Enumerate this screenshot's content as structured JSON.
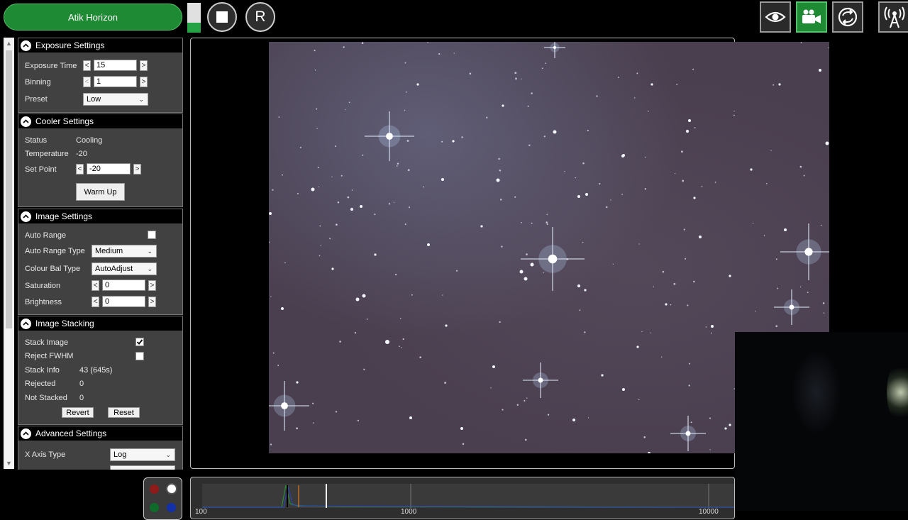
{
  "top": {
    "camera_name": "Atik Horizon",
    "reset_label": "R",
    "level": 0.33,
    "colors": {
      "accent_green": "#1f8a34",
      "panel": "#414141"
    }
  },
  "toolbar_icons": [
    "eye-icon",
    "video-camera-icon",
    "sync-icon",
    "antenna-icon"
  ],
  "exposure": {
    "title": "Exposure Settings",
    "exposure_label": "Exposure Time",
    "exposure_value": "15",
    "binning_label": "Binning",
    "binning_value": "1",
    "preset_label": "Preset",
    "preset_value": "Low",
    "dec": "<",
    "inc": ">"
  },
  "cooler": {
    "title": "Cooler Settings",
    "status_label": "Status",
    "status_value": "Cooling",
    "temp_label": "Temperature",
    "temp_value": "-20",
    "setpoint_label": "Set Point",
    "setpoint_value": "-20",
    "warm_up": "Warm Up"
  },
  "image": {
    "title": "Image Settings",
    "auto_range_label": "Auto Range",
    "auto_range_checked": false,
    "art_label": "Auto Range Type",
    "art_value": "Medium",
    "cbt_label": "Colour Bal Type",
    "cbt_value": "AutoAdjust",
    "saturation_label": "Saturation",
    "saturation_value": "0",
    "brightness_label": "Brightness",
    "brightness_value": "0"
  },
  "stacking": {
    "title": "Image Stacking",
    "stack_label": "Stack Image",
    "stack_checked": true,
    "reject_label": "Reject FWHM",
    "reject_checked": false,
    "info_label": "Stack Info",
    "info_value": "43 (645s)",
    "rejected_label": "Rejected",
    "rejected_value": "0",
    "notstacked_label": "Not Stacked",
    "notstacked_value": "0",
    "revert": "Revert",
    "reset": "Reset"
  },
  "advanced": {
    "title": "Advanced Settings",
    "xaxis_label": "X Axis Type",
    "xaxis_value": "Log"
  },
  "histogram": {
    "ticks": [
      "100",
      "1000",
      "10000"
    ]
  }
}
